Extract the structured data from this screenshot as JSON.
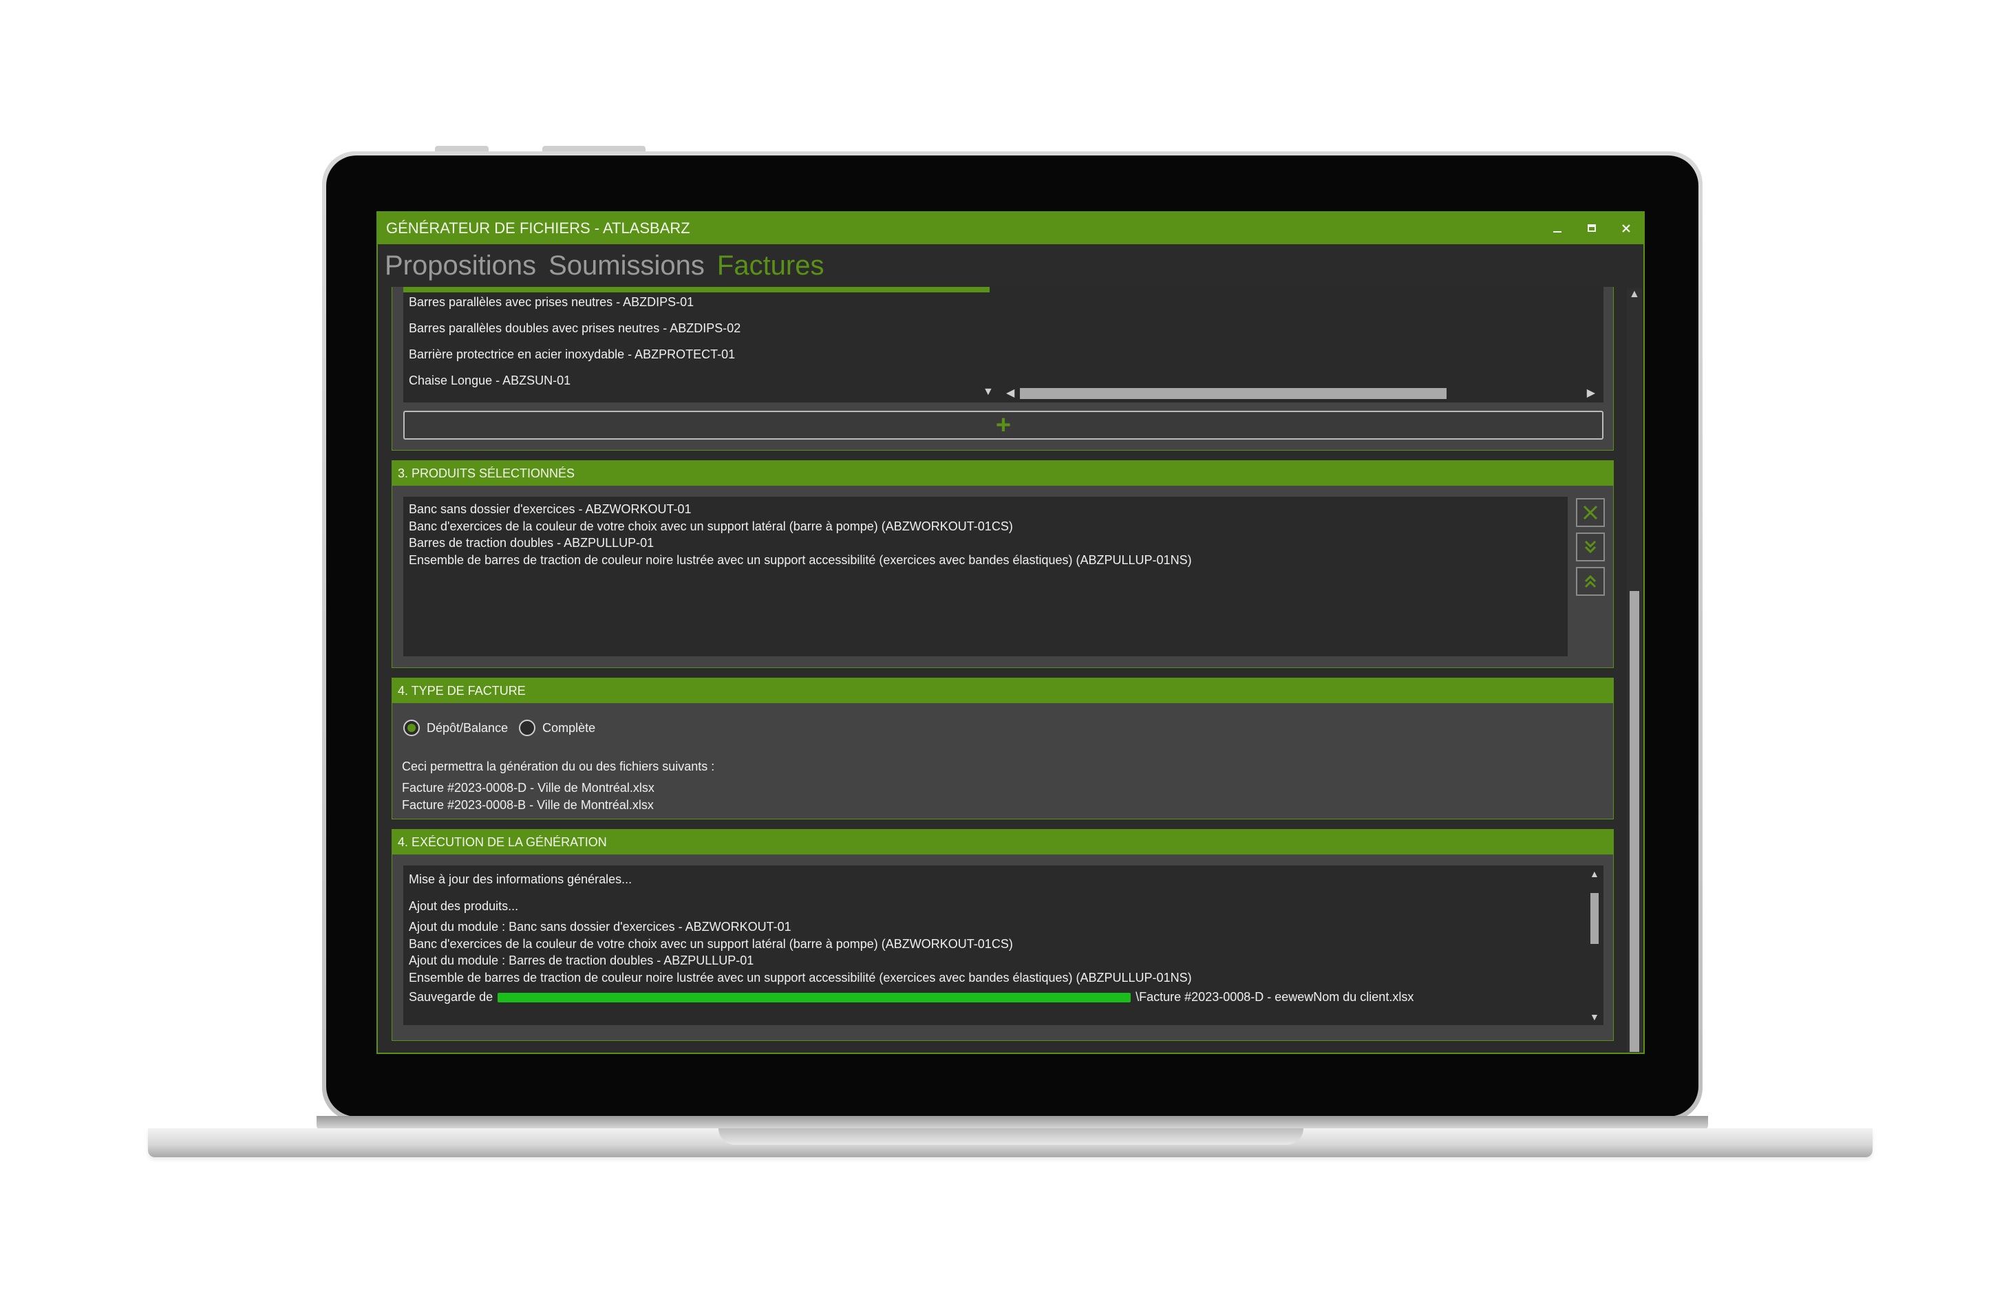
{
  "window": {
    "title": "GÉNÉRATEUR DE FICHIERS - ATLASBARZ",
    "minimize_icon": "minimize-icon",
    "maximize_icon": "maximize-icon",
    "close_icon": "close-icon"
  },
  "tabs": [
    {
      "label": "Propositions",
      "active": false
    },
    {
      "label": "Soumissions",
      "active": false
    },
    {
      "label": "Factures",
      "active": true
    }
  ],
  "products_list": {
    "items": [
      "Barres parallèles avec prises neutres - ABZDIPS-01",
      "Barres parallèles doubles avec prises neutres - ABZDIPS-02",
      "Barrière protectrice en acier inoxydable - ABZPROTECT-01",
      "Chaise Longue - ABZSUN-01"
    ],
    "add_label": "+"
  },
  "selected_products": {
    "header": "3. PRODUITS SÉLECTIONNÉS",
    "items": [
      "Banc sans dossier d'exercices - ABZWORKOUT-01",
      "Banc d'exercices de la couleur de votre choix avec un support latéral (barre à pompe) (ABZWORKOUT-01CS)",
      "Barres de traction doubles - ABZPULLUP-01",
      "Ensemble de barres de traction de couleur noire lustrée avec un support accessibilité (exercices avec bandes élastiques) (ABZPULLUP-01NS)"
    ],
    "buttons": [
      "remove-icon",
      "move-down-icon",
      "move-up-icon"
    ]
  },
  "invoice_type": {
    "header": "4. TYPE DE FACTURE",
    "options": [
      {
        "label": "Dépôt/Balance",
        "selected": true
      },
      {
        "label": "Complète",
        "selected": false
      }
    ],
    "info_label": "Ceci permettra la génération du ou des fichiers suivants :",
    "files": [
      "Facture #2023-0008-D - Ville de Montréal.xlsx",
      "Facture #2023-0008-B - Ville de Montréal.xlsx"
    ]
  },
  "execution": {
    "header": "4. EXÉCUTION DE LA GÉNÉRATION",
    "lines": [
      "Mise à jour des informations générales...",
      "Ajout des produits...",
      "Ajout du module : Banc sans dossier d'exercices - ABZWORKOUT-01",
      "Banc d'exercices de la couleur de votre choix avec un support latéral (barre à pompe) (ABZWORKOUT-01CS)",
      "Ajout du module : Barres de traction doubles - ABZPULLUP-01",
      "Ensemble de barres de traction de couleur noire lustrée avec un support accessibilité (exercices avec bandes élastiques) (ABZPULLUP-01NS)"
    ],
    "save_prefix": "Sauvegarde de",
    "save_suffix": "\\Facture #2023-0008-D - eewewNom du client.xlsx"
  },
  "colors": {
    "accent": "#5a9218",
    "background": "#2b2b2b",
    "panel": "#444444"
  }
}
